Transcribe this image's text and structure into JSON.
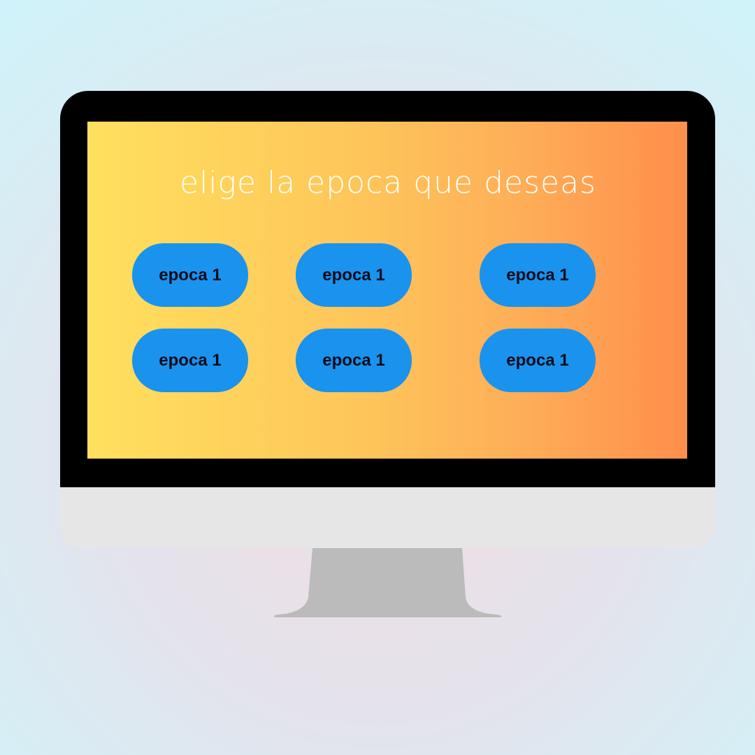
{
  "screen": {
    "heading": "elige la epoca que deseas",
    "buttons": [
      {
        "label": "epoca 1"
      },
      {
        "label": "epoca 1"
      },
      {
        "label": "epoca 1"
      },
      {
        "label": "epoca 1"
      },
      {
        "label": "epoca 1"
      },
      {
        "label": "epoca 1"
      }
    ]
  },
  "colors": {
    "button_fill": "#1a93ee",
    "button_text": "#0c0c1a",
    "heading_text": "#fffdf5",
    "screen_gradient_start": "#ffe05e",
    "screen_gradient_end": "#ff8f4c",
    "bezel": "#000000",
    "chin": "#e6e6e6",
    "stand": "#bbbbbb"
  }
}
